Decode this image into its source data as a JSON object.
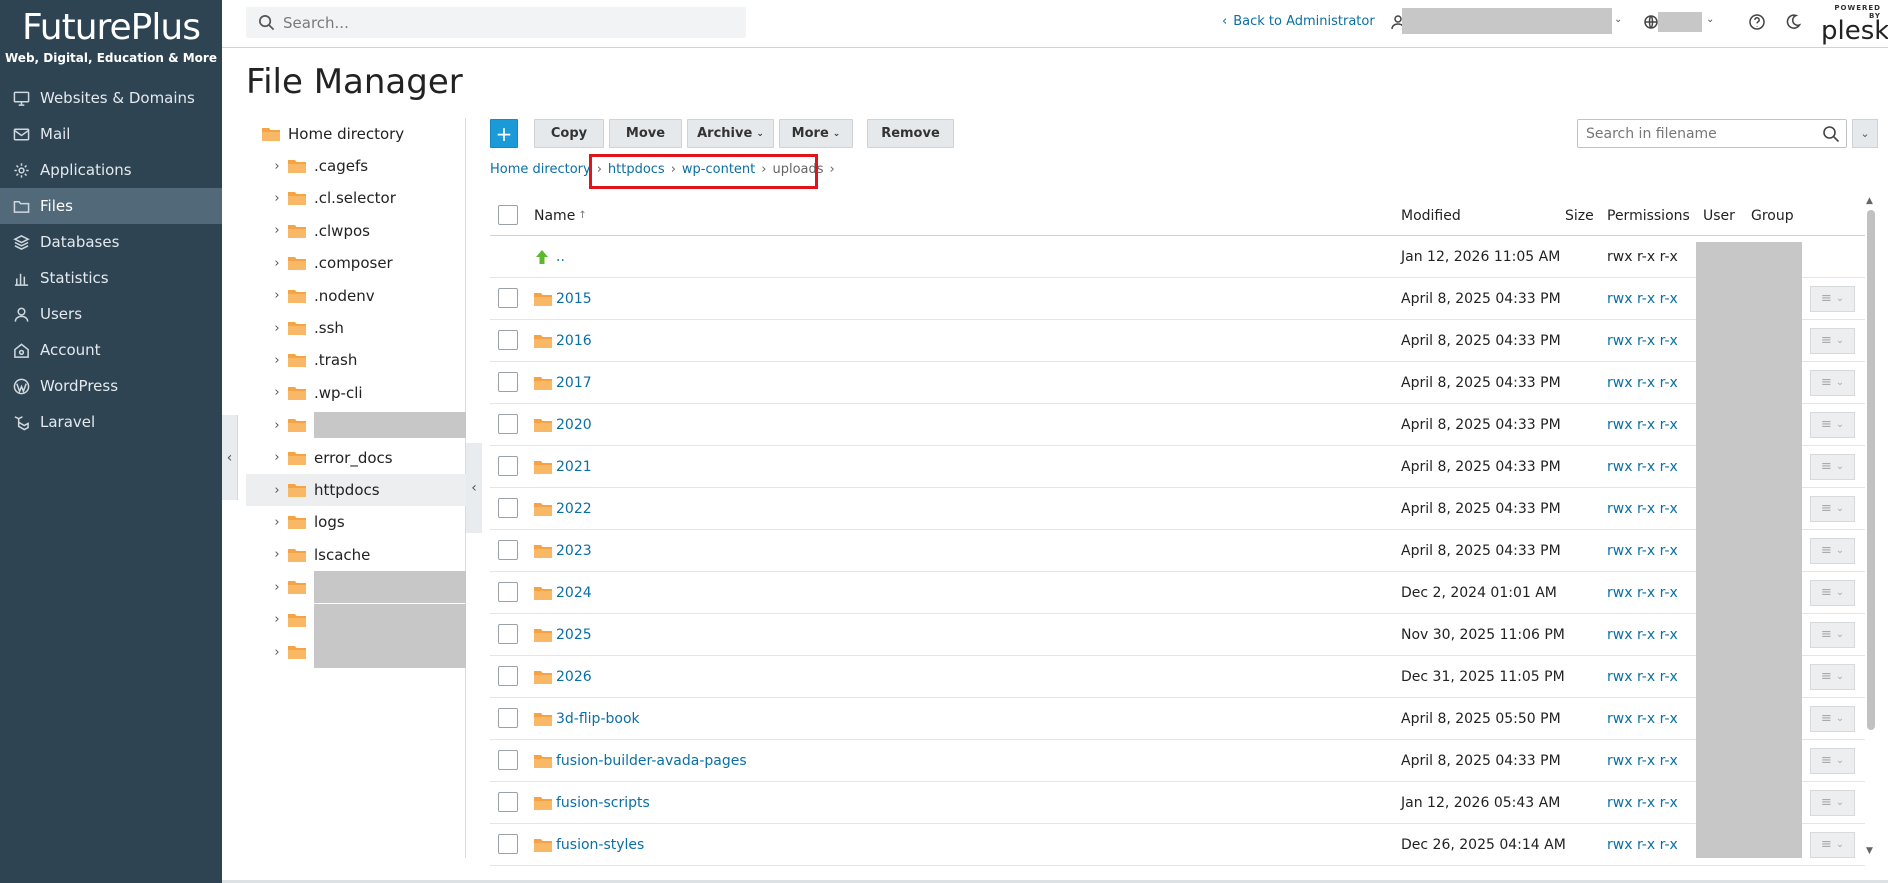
{
  "brand": {
    "name": "FuturePlus",
    "tagline": "Web, Digital, Education & More"
  },
  "header": {
    "search_placeholder": "Search...",
    "back_link": "Back to Administrator",
    "powered_by": "POWERED BY",
    "plesk": "plesk"
  },
  "nav": [
    {
      "label": "Websites & Domains",
      "icon": "monitor-icon"
    },
    {
      "label": "Mail",
      "icon": "mail-icon"
    },
    {
      "label": "Applications",
      "icon": "gear-icon"
    },
    {
      "label": "Files",
      "icon": "folder-icon",
      "active": true
    },
    {
      "label": "Databases",
      "icon": "database-icon"
    },
    {
      "label": "Statistics",
      "icon": "bar-chart-icon"
    },
    {
      "label": "Users",
      "icon": "user-icon"
    },
    {
      "label": "Account",
      "icon": "account-icon"
    },
    {
      "label": "WordPress",
      "icon": "wordpress-icon"
    },
    {
      "label": "Laravel",
      "icon": "laravel-icon"
    }
  ],
  "page_title": "File Manager",
  "tree": {
    "root": "Home directory",
    "items": [
      ".cagefs",
      ".cl.selector",
      ".clwpos",
      ".composer",
      ".nodenv",
      ".ssh",
      ".trash",
      ".wp-cli",
      "",
      "error_docs",
      "httpdocs",
      "logs",
      "lscache",
      "",
      "",
      ""
    ]
  },
  "toolbar": {
    "add": "+",
    "copy": "Copy",
    "move": "Move",
    "archive": "Archive",
    "more": "More",
    "remove": "Remove",
    "search_placeholder": "Search in filename"
  },
  "breadcrumb": [
    "Home directory",
    "httpdocs",
    "wp-content",
    "uploads"
  ],
  "table": {
    "headers": {
      "name": "Name",
      "modified": "Modified",
      "size": "Size",
      "permissions": "Permissions",
      "user": "User",
      "group": "Group"
    },
    "parent": {
      "name": "..",
      "modified": "Jan 12, 2026 11:05 AM",
      "permissions": "rwx r-x r-x"
    },
    "rows": [
      {
        "name": "2015",
        "modified": "April 8, 2025 04:33 PM",
        "permissions": "rwx r-x r-x"
      },
      {
        "name": "2016",
        "modified": "April 8, 2025 04:33 PM",
        "permissions": "rwx r-x r-x"
      },
      {
        "name": "2017",
        "modified": "April 8, 2025 04:33 PM",
        "permissions": "rwx r-x r-x"
      },
      {
        "name": "2020",
        "modified": "April 8, 2025 04:33 PM",
        "permissions": "rwx r-x r-x"
      },
      {
        "name": "2021",
        "modified": "April 8, 2025 04:33 PM",
        "permissions": "rwx r-x r-x"
      },
      {
        "name": "2022",
        "modified": "April 8, 2025 04:33 PM",
        "permissions": "rwx r-x r-x"
      },
      {
        "name": "2023",
        "modified": "April 8, 2025 04:33 PM",
        "permissions": "rwx r-x r-x"
      },
      {
        "name": "2024",
        "modified": "Dec 2, 2024 01:01 AM",
        "permissions": "rwx r-x r-x"
      },
      {
        "name": "2025",
        "modified": "Nov 30, 2025 11:06 PM",
        "permissions": "rwx r-x r-x"
      },
      {
        "name": "2026",
        "modified": "Dec 31, 2025 11:05 PM",
        "permissions": "rwx r-x r-x"
      },
      {
        "name": "3d-flip-book",
        "modified": "April 8, 2025 05:50 PM",
        "permissions": "rwx r-x r-x"
      },
      {
        "name": "fusion-builder-avada-pages",
        "modified": "April 8, 2025 04:33 PM",
        "permissions": "rwx r-x r-x"
      },
      {
        "name": "fusion-scripts",
        "modified": "Jan 12, 2026 05:43 AM",
        "permissions": "rwx r-x r-x"
      },
      {
        "name": "fusion-styles",
        "modified": "Dec 26, 2025 04:14 AM",
        "permissions": "rwx r-x r-x"
      }
    ]
  },
  "colors": {
    "sidebar": "#2e4453",
    "accent": "#1a9ad6",
    "link": "#0a6fa3",
    "folder": "#f5a445",
    "highlight": "#e0151b"
  }
}
